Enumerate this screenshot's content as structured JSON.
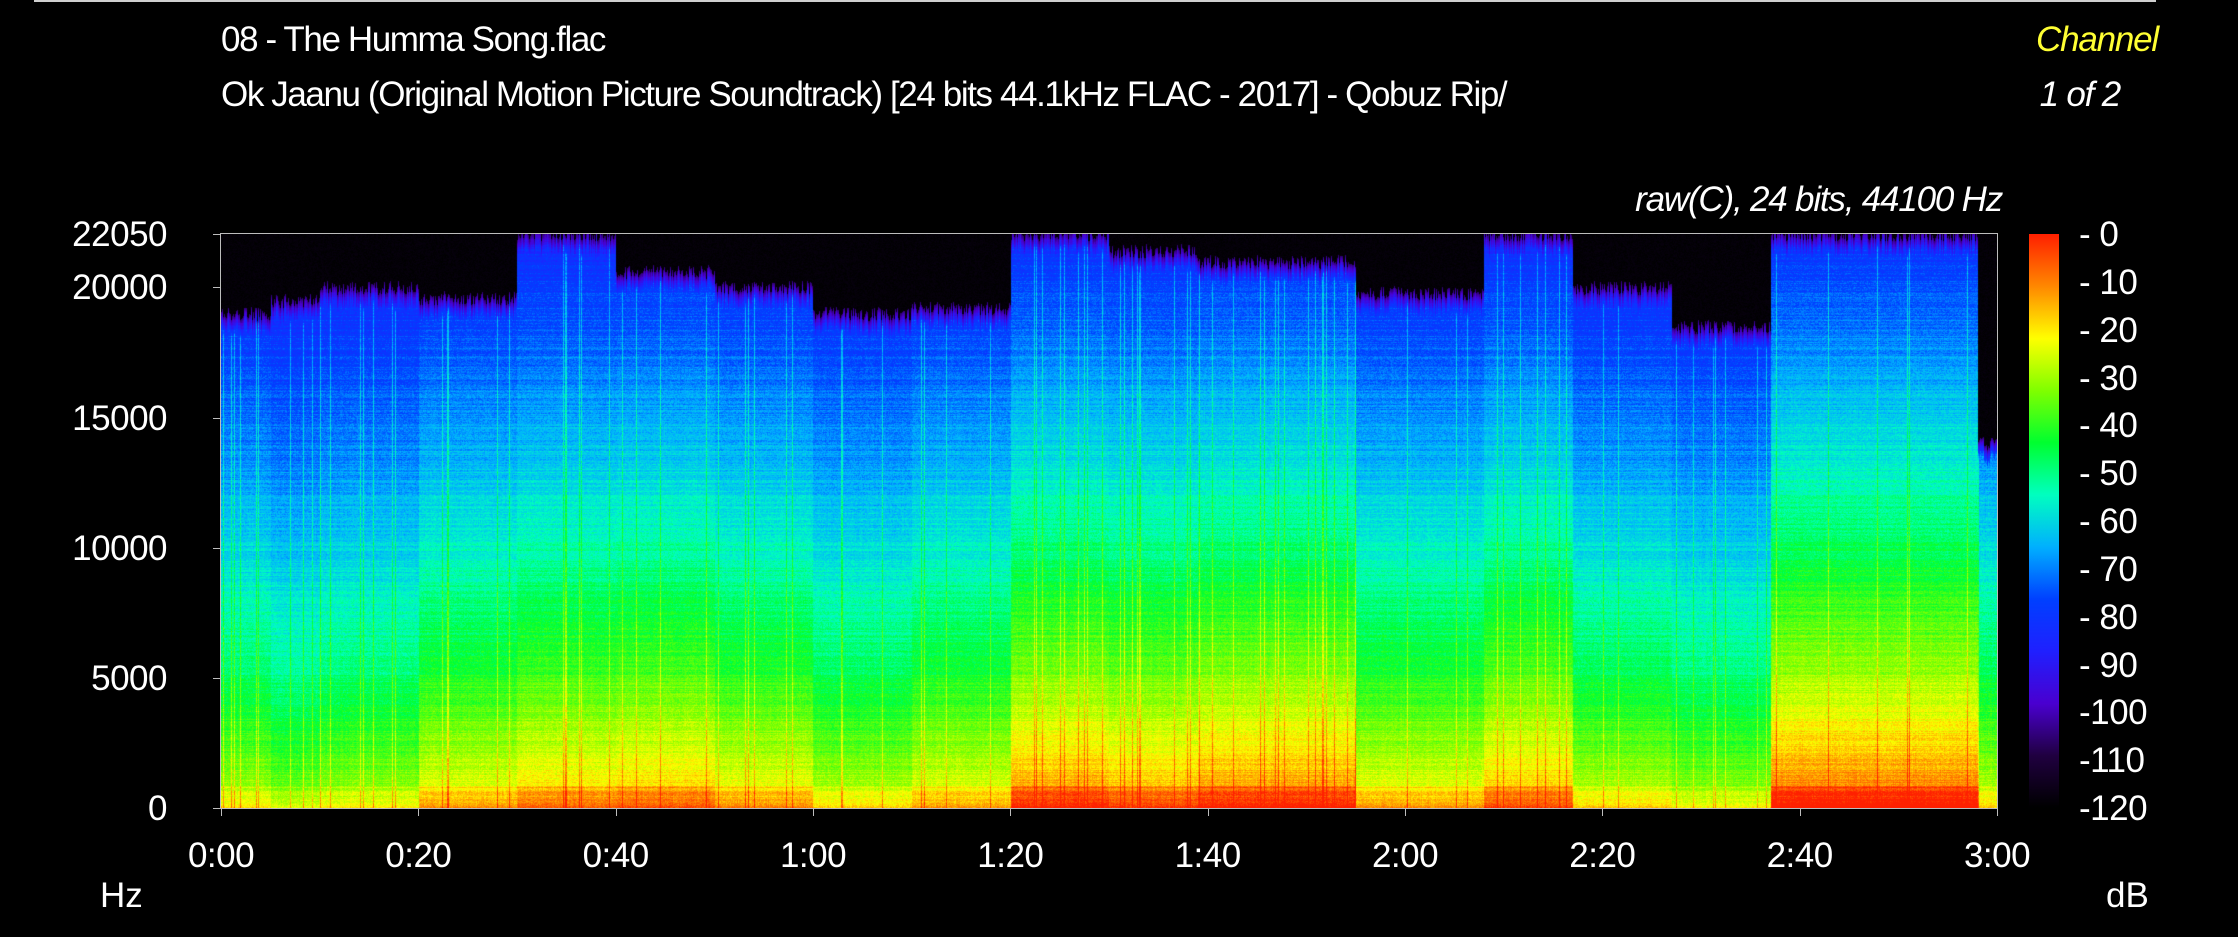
{
  "header": {
    "file": "08 - The Humma Song.flac",
    "album": "Ok Jaanu (Original Motion Picture Soundtrack) [24 bits 44.1kHz FLAC - 2017] - Qobuz Rip/",
    "channel_label": "Channel",
    "channel_count": "1 of 2",
    "format_info": "raw(C), 24 bits, 44100 Hz"
  },
  "colors": {
    "background": "#000000",
    "title": "#ffffff",
    "channel": "#ffff33",
    "frame": "#bdbdbd"
  },
  "chart_data": {
    "type": "heatmap",
    "subtype": "spectrogram",
    "x_tick_labels": [
      "0:00",
      "0:20",
      "0:40",
      "1:00",
      "1:20",
      "1:40",
      "2:00",
      "2:20",
      "2:40",
      "3:00"
    ],
    "x_range_seconds": [
      0,
      180
    ],
    "y_tick_labels": [
      "22050",
      "20000",
      "15000",
      "10000",
      "5000",
      "0"
    ],
    "y_tick_values": [
      22050,
      20000,
      15000,
      10000,
      5000,
      0
    ],
    "y_range_hz": [
      0,
      22050
    ],
    "y_unit": "Hz",
    "colorbar": {
      "unit": "dB",
      "tick_labels": [
        "- 0",
        "- 10",
        "- 20",
        "- 30",
        "- 40",
        "- 50",
        "- 60",
        "- 70",
        "- 80",
        "- 90",
        "-100",
        "-110",
        "-120"
      ],
      "tick_values": [
        0,
        -10,
        -20,
        -30,
        -40,
        -50,
        -60,
        -70,
        -80,
        -90,
        -100,
        -110,
        -120
      ],
      "range_db": [
        -120,
        0
      ],
      "colormap": [
        "#ff2000",
        "#ff8800",
        "#ffff00",
        "#80ff00",
        "#00ff30",
        "#00ffc0",
        "#00b0ff",
        "#0040ff",
        "#2020ff",
        "#4a00d0",
        "#200040",
        "#000000"
      ]
    },
    "segments": [
      {
        "t": [
          0,
          5
        ],
        "level": 0.45,
        "cutoff": 19000
      },
      {
        "t": [
          5,
          10
        ],
        "level": 0.35,
        "cutoff": 19500
      },
      {
        "t": [
          10,
          20
        ],
        "level": 0.42,
        "cutoff": 20000
      },
      {
        "t": [
          20,
          30
        ],
        "level": 0.62,
        "cutoff": 19600
      },
      {
        "t": [
          30,
          40
        ],
        "level": 0.72,
        "cutoff": 22050
      },
      {
        "t": [
          40,
          50
        ],
        "level": 0.76,
        "cutoff": 20600
      },
      {
        "t": [
          50,
          60
        ],
        "level": 0.65,
        "cutoff": 20000
      },
      {
        "t": [
          60,
          70
        ],
        "level": 0.48,
        "cutoff": 19000
      },
      {
        "t": [
          70,
          80
        ],
        "level": 0.6,
        "cutoff": 19200
      },
      {
        "t": [
          80,
          90
        ],
        "level": 0.88,
        "cutoff": 22050
      },
      {
        "t": [
          90,
          99
        ],
        "level": 0.82,
        "cutoff": 21400
      },
      {
        "t": [
          99,
          115
        ],
        "level": 0.9,
        "cutoff": 21000
      },
      {
        "t": [
          115,
          128
        ],
        "level": 0.62,
        "cutoff": 19800
      },
      {
        "t": [
          128,
          137
        ],
        "level": 0.78,
        "cutoff": 22050
      },
      {
        "t": [
          137,
          147
        ],
        "level": 0.5,
        "cutoff": 20000
      },
      {
        "t": [
          147,
          157
        ],
        "level": 0.4,
        "cutoff": 18500
      },
      {
        "t": [
          157,
          178
        ],
        "level": 0.97,
        "cutoff": 22050
      },
      {
        "t": [
          178,
          180
        ],
        "level": 0.5,
        "cutoff": 14000
      }
    ]
  }
}
